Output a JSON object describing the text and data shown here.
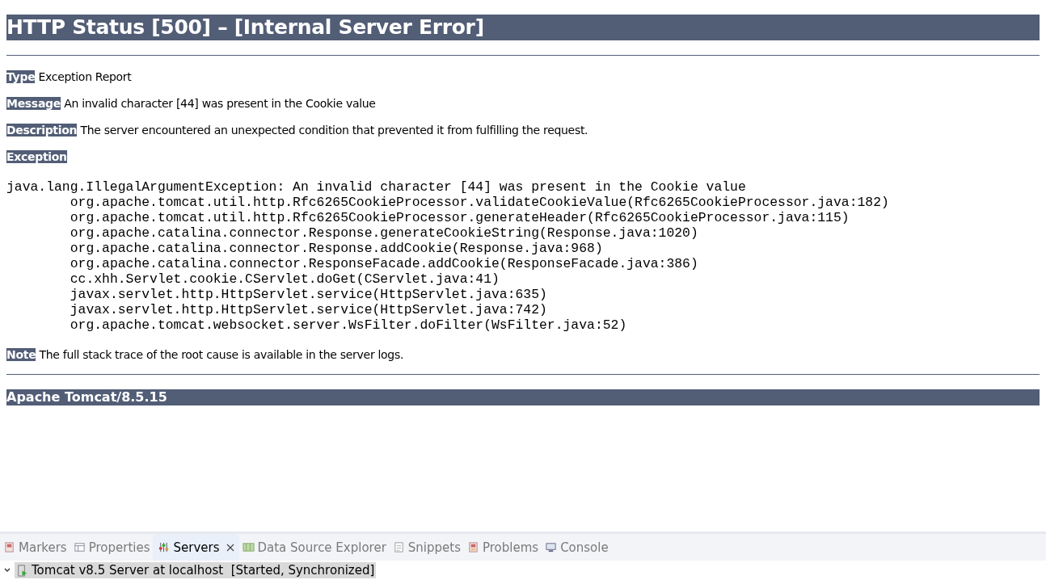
{
  "title": "HTTP Status [500] – [Internal Server Error]",
  "fields": [
    {
      "label": "Type",
      "text": "Exception Report"
    },
    {
      "label": "Message",
      "text": "An invalid character [44] was present in the Cookie value"
    },
    {
      "label": "Description",
      "text": "The server encountered an unexpected condition that prevented it from fulfilling the request."
    },
    {
      "label": "Exception"
    }
  ],
  "stack_trace": [
    "java.lang.IllegalArgumentException: An invalid character [44] was present in the Cookie value",
    "\torg.apache.tomcat.util.http.Rfc6265CookieProcessor.validateCookieValue(Rfc6265CookieProcessor.java:182)",
    "\torg.apache.tomcat.util.http.Rfc6265CookieProcessor.generateHeader(Rfc6265CookieProcessor.java:115)",
    "\torg.apache.catalina.connector.Response.generateCookieString(Response.java:1020)",
    "\torg.apache.catalina.connector.Response.addCookie(Response.java:968)",
    "\torg.apache.catalina.connector.ResponseFacade.addCookie(ResponseFacade.java:386)",
    "\tcc.xhh.Servlet.cookie.CServlet.doGet(CServlet.java:41)",
    "\tjavax.servlet.http.HttpServlet.service(HttpServlet.java:635)",
    "\tjavax.servlet.http.HttpServlet.service(HttpServlet.java:742)",
    "\torg.apache.tomcat.websocket.server.WsFilter.doFilter(WsFilter.java:52)"
  ],
  "note": {
    "label": "Note",
    "text": "The full stack trace of the root cause is available in the server logs."
  },
  "footer": "Apache Tomcat/8.5.15",
  "panel_tabs": [
    {
      "label": "Markers",
      "kind": "markers",
      "selected": false
    },
    {
      "label": "Properties",
      "kind": "properties",
      "selected": false
    },
    {
      "label": "Servers",
      "kind": "servers",
      "selected": true
    },
    {
      "label": "Data Source Explorer",
      "kind": "datasource",
      "selected": false
    },
    {
      "label": "Snippets",
      "kind": "snippets",
      "selected": false
    },
    {
      "label": "Problems",
      "kind": "problems",
      "selected": false
    },
    {
      "label": "Console",
      "kind": "console",
      "selected": false
    }
  ],
  "servers": [
    {
      "name": "Tomcat v8.5 Server at localhost",
      "status": "[Started, Synchronized]",
      "expanded": false,
      "selected": true
    }
  ]
}
